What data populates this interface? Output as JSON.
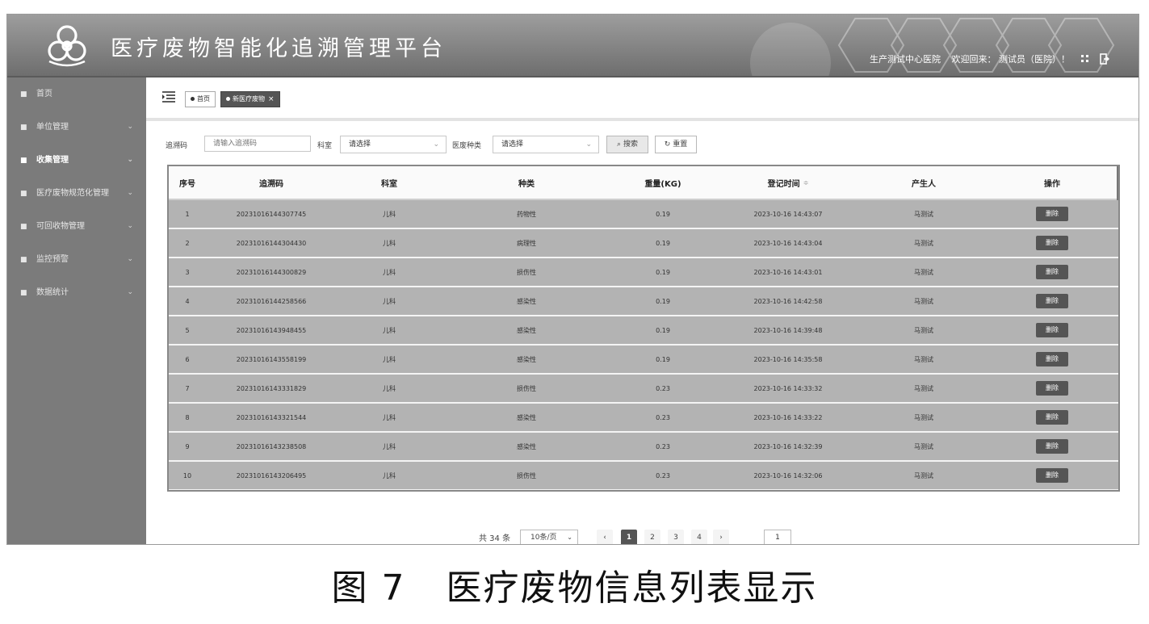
{
  "header": {
    "title": "医疗废物智能化追溯管理平台",
    "hospital": "生产测试中心医院",
    "welcome": "欢迎回来： 测试员（医院）！"
  },
  "sidebar": {
    "items": [
      {
        "label": "首页",
        "icon": "home-icon",
        "chevron": false
      },
      {
        "label": "单位管理",
        "icon": "building-icon",
        "chevron": true
      },
      {
        "label": "收集管理",
        "icon": "collect-icon",
        "chevron": true
      },
      {
        "label": "医疗废物规范化管理",
        "icon": "doc-icon",
        "chevron": true
      },
      {
        "label": "可回收物管理",
        "icon": "recycle-icon",
        "chevron": true
      },
      {
        "label": "监控预警",
        "icon": "monitor-icon",
        "chevron": true
      },
      {
        "label": "数据统计",
        "icon": "chart-icon",
        "chevron": true
      }
    ],
    "active_index": 2
  },
  "tabs": {
    "home": "首页",
    "current": "新医疗废物",
    "close": "×"
  },
  "filters": {
    "trace_label": "追溯码",
    "trace_placeholder": "请输入追溯码",
    "dept_label": "科室",
    "dept_value": "请选择",
    "type_label": "医废种类",
    "type_value": "请选择",
    "search_label": "搜索",
    "reset_label": "重置"
  },
  "table": {
    "columns": [
      "序号",
      "追溯码",
      "科室",
      "种类",
      "重量(KG)",
      "登记时间",
      "产生人",
      "操作"
    ],
    "sort_mark": "≑",
    "delete_label": "删除",
    "rows": [
      {
        "no": "1",
        "code": "20231016144307745",
        "dept": "儿科",
        "type": "药物性",
        "weight": "0.19",
        "time": "2023-10-16 14:43:07",
        "person": "马测试"
      },
      {
        "no": "2",
        "code": "20231016144304430",
        "dept": "儿科",
        "type": "病理性",
        "weight": "0.19",
        "time": "2023-10-16 14:43:04",
        "person": "马测试"
      },
      {
        "no": "3",
        "code": "20231016144300829",
        "dept": "儿科",
        "type": "损伤性",
        "weight": "0.19",
        "time": "2023-10-16 14:43:01",
        "person": "马测试"
      },
      {
        "no": "4",
        "code": "20231016144258566",
        "dept": "儿科",
        "type": "感染性",
        "weight": "0.19",
        "time": "2023-10-16 14:42:58",
        "person": "马测试"
      },
      {
        "no": "5",
        "code": "20231016143948455",
        "dept": "儿科",
        "type": "感染性",
        "weight": "0.19",
        "time": "2023-10-16 14:39:48",
        "person": "马测试"
      },
      {
        "no": "6",
        "code": "20231016143558199",
        "dept": "儿科",
        "type": "感染性",
        "weight": "0.19",
        "time": "2023-10-16 14:35:58",
        "person": "马测试"
      },
      {
        "no": "7",
        "code": "20231016143331829",
        "dept": "儿科",
        "type": "损伤性",
        "weight": "0.23",
        "time": "2023-10-16 14:33:32",
        "person": "马测试"
      },
      {
        "no": "8",
        "code": "20231016143321544",
        "dept": "儿科",
        "type": "感染性",
        "weight": "0.23",
        "time": "2023-10-16 14:33:22",
        "person": "马测试"
      },
      {
        "no": "9",
        "code": "20231016143238508",
        "dept": "儿科",
        "type": "感染性",
        "weight": "0.23",
        "time": "2023-10-16 14:32:39",
        "person": "马测试"
      },
      {
        "no": "10",
        "code": "20231016143206495",
        "dept": "儿科",
        "type": "损伤性",
        "weight": "0.23",
        "time": "2023-10-16 14:32:06",
        "person": "马测试"
      }
    ]
  },
  "pagination": {
    "total": "共 34 条",
    "page_size": "10条/页",
    "prev": "‹",
    "next": "›",
    "pages": [
      "1",
      "2",
      "3",
      "4"
    ],
    "current_page": "1",
    "jump_value": "1"
  },
  "caption": {
    "figure": "图 7",
    "text": "医疗废物信息列表显示"
  },
  "colors": {
    "header_bg": "#7d7d7d",
    "sidebar_bg": "#7b7b7b",
    "row_bg": "#b3b3b3",
    "active_btn": "#555555"
  }
}
